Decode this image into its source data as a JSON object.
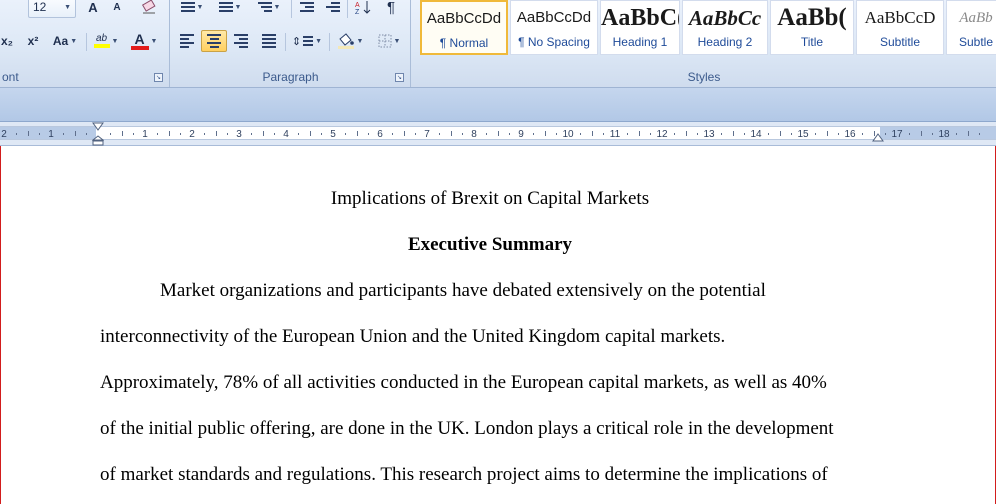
{
  "ribbon": {
    "font_group": {
      "label": "ont",
      "font_size": "12",
      "grow_font": "A",
      "shrink_font": "A",
      "subscript": "x₂",
      "superscript": "x²",
      "change_case": "Aa",
      "highlight_label": "ab",
      "font_color_label": "A",
      "highlight_color": "#ffff00",
      "font_color": "#e21b1b"
    },
    "paragraph_group": {
      "label": "Paragraph"
    },
    "styles_group": {
      "label": "Styles",
      "tiles": [
        {
          "sample": "AaBbCcDd",
          "name": "¶ Normal"
        },
        {
          "sample": "AaBbCcDd",
          "name": "¶ No Spacing"
        },
        {
          "sample": "AaBbC(",
          "name": "Heading 1"
        },
        {
          "sample": "AaBbCc",
          "name": "Heading 2"
        },
        {
          "sample": "AaBb(",
          "name": "Title"
        },
        {
          "sample": "AaBbCcD",
          "name": "Subtitle"
        },
        {
          "sample": "AaBb",
          "name": "Subtle"
        }
      ]
    }
  },
  "ruler": {
    "labels": [
      "2",
      "1",
      "1",
      "2",
      "3",
      "4",
      "5",
      "6",
      "7",
      "8",
      "9",
      "10",
      "11",
      "12",
      "13",
      "14",
      "15",
      "16",
      "17",
      "18"
    ]
  },
  "document": {
    "title": "Implications of Brexit on Capital Markets",
    "heading": "Executive Summary",
    "paragraph_lines": [
      "Market organizations and participants have debated extensively on the potential",
      "interconnectivity of the European Union and the United Kingdom capital markets.",
      "Approximately, 78% of all activities conducted in the European capital markets, as well as 40%",
      "of the initial public offering, are done in the UK. London plays a critical role in the development",
      "of market standards and regulations. This research project aims to determine the implications of"
    ]
  },
  "colors": {
    "ribbon_accent": "#3b5a8c",
    "selected_style_border": "#f0b93a",
    "window_border": "#d21d1d"
  }
}
